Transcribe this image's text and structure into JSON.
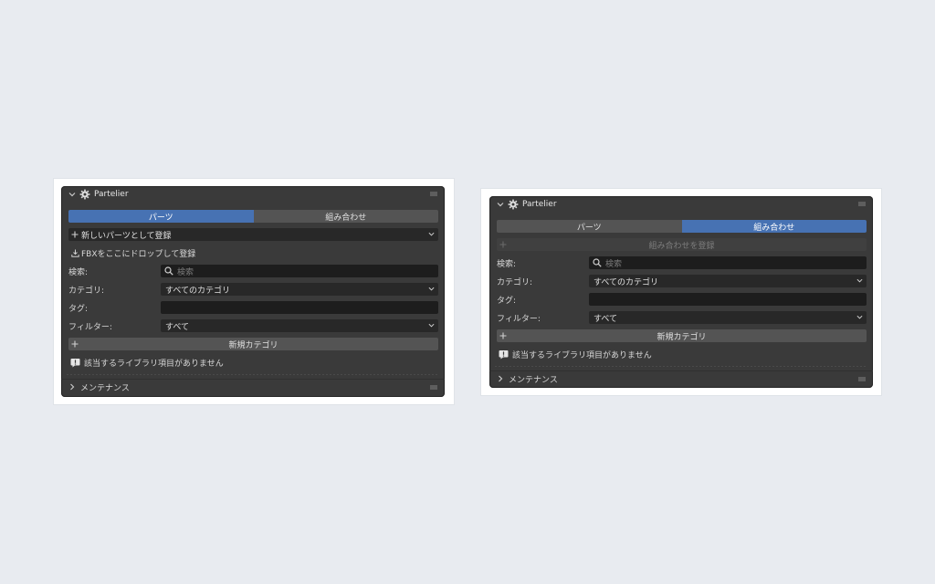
{
  "panel_left": {
    "title": "Partelier",
    "tabs": [
      "パーツ",
      "組み合わせ"
    ],
    "active_tab": 0,
    "register_new": "新しいパーツとして登録",
    "fbx_drop": "FBXをここにドロップして登録",
    "search_label": "検索:",
    "search_placeholder": "検索",
    "category_label": "カテゴリ:",
    "category_value": "すべてのカテゴリ",
    "tag_label": "タグ:",
    "filter_label": "フィルター:",
    "filter_value": "すべて",
    "new_category": "新規カテゴリ",
    "empty_message": "該当するライブラリ項目がありません",
    "maintenance": "メンテナンス"
  },
  "panel_right": {
    "title": "Partelier",
    "tabs": [
      "パーツ",
      "組み合わせ"
    ],
    "active_tab": 1,
    "register_combo": "組み合わせを登録",
    "search_label": "検索:",
    "search_placeholder": "検索",
    "category_label": "カテゴリ:",
    "category_value": "すべてのカテゴリ",
    "tag_label": "タグ:",
    "filter_label": "フィルター:",
    "filter_value": "すべて",
    "new_category": "新規カテゴリ",
    "empty_message": "該当するライブラリ項目がありません",
    "maintenance": "メンテナンス"
  },
  "colors": {
    "page_bg": "#e8ebf0",
    "panel_bg": "#3a3a3a",
    "accent": "#4772b3",
    "field_bg": "#1d1d1d"
  }
}
